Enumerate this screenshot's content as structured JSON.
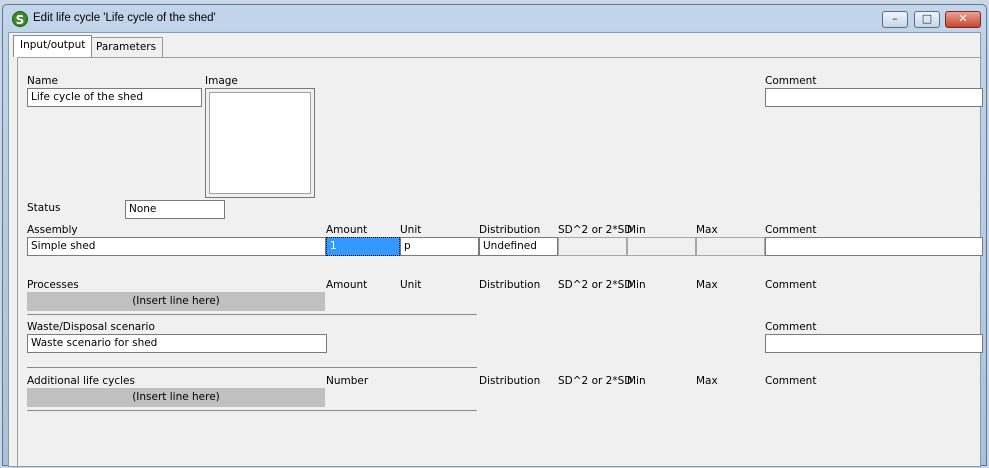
{
  "window": {
    "title": "Edit life cycle 'Life cycle of the shed'",
    "icon_letter": "S",
    "minimize_glyph": "–",
    "maximize_glyph": "□",
    "close_glyph": "✕"
  },
  "tabs": [
    {
      "label": "Input/output",
      "active": true
    },
    {
      "label": "Parameters",
      "active": false
    }
  ],
  "form": {
    "name_label": "Name",
    "name_value": "Life cycle of the shed",
    "image_label": "Image",
    "comment_label": "Comment",
    "comment_value": "",
    "status_label": "Status",
    "status_value": "None"
  },
  "assembly": {
    "header": {
      "assembly": "Assembly",
      "amount": "Amount",
      "unit": "Unit",
      "distribution": "Distribution",
      "sd": "SD^2 or 2*SD",
      "min": "Min",
      "max": "Max",
      "comment": "Comment"
    },
    "row": {
      "name": "Simple shed",
      "amount": "1",
      "unit": "p",
      "distribution": "Undefined",
      "sd": "",
      "min": "",
      "max": "",
      "comment": ""
    }
  },
  "processes": {
    "header": {
      "processes": "Processes",
      "amount": "Amount",
      "unit": "Unit",
      "distribution": "Distribution",
      "sd": "SD^2 or 2*SD",
      "min": "Min",
      "max": "Max",
      "comment": "Comment"
    },
    "insert_label": "(Insert line here)"
  },
  "waste": {
    "label": "Waste/Disposal scenario",
    "value": "Waste scenario for shed",
    "comment_label": "Comment",
    "comment_value": ""
  },
  "additional": {
    "header": {
      "label": "Additional life cycles",
      "number": "Number",
      "distribution": "Distribution",
      "sd": "SD^2 or 2*SD",
      "min": "Min",
      "max": "Max",
      "comment": "Comment"
    },
    "insert_label": "(Insert line here)"
  }
}
